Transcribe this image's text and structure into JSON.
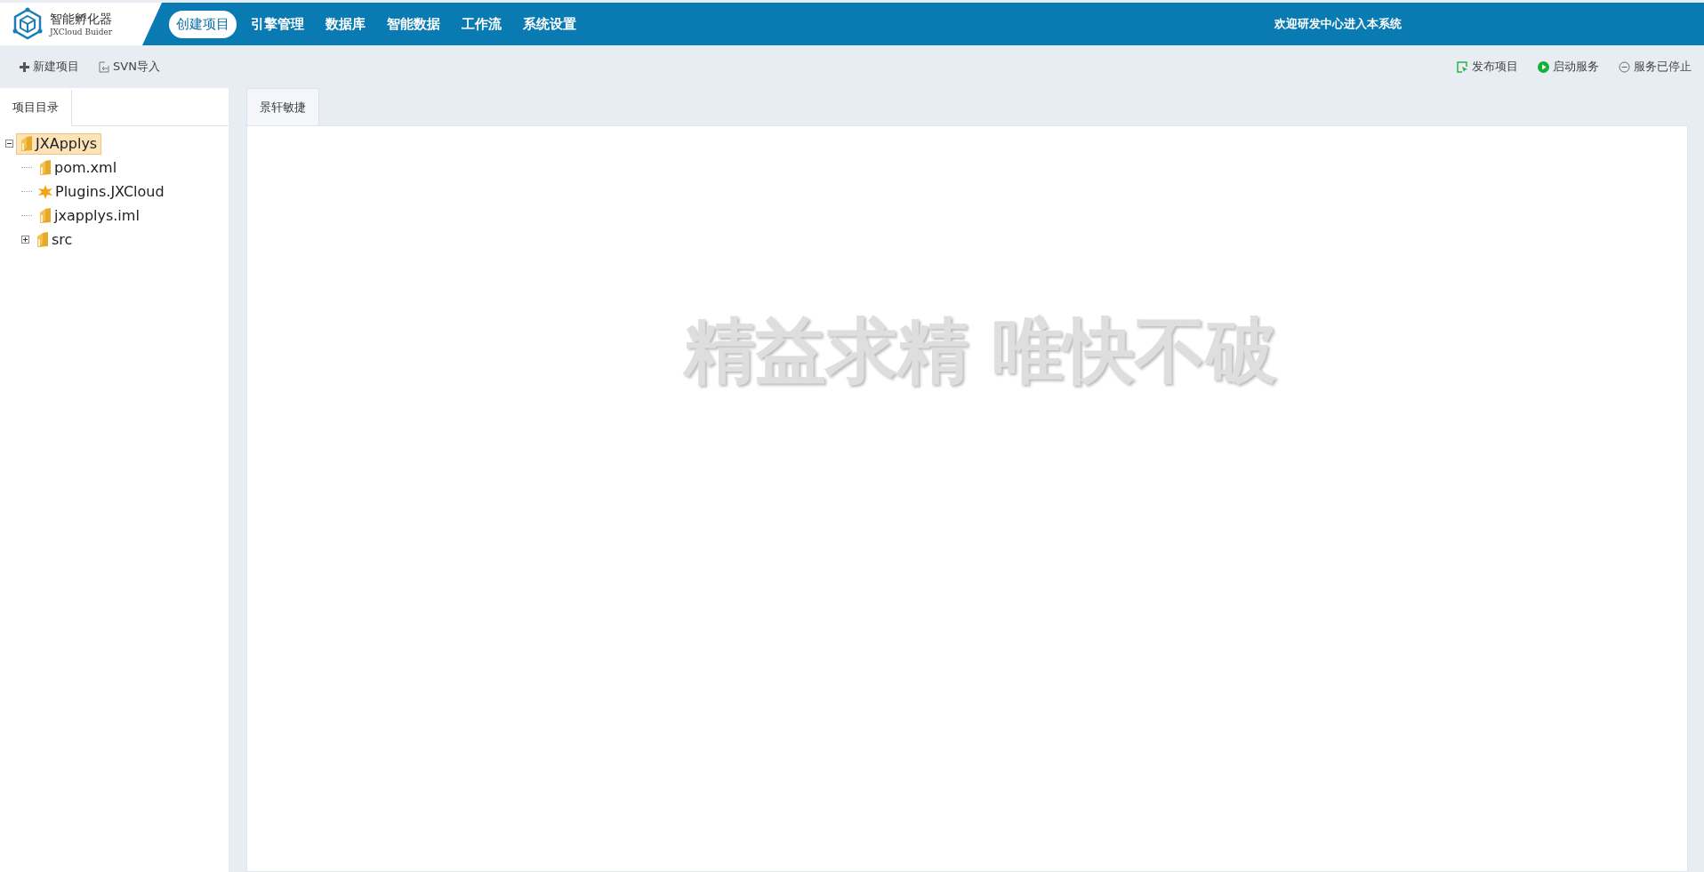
{
  "logo": {
    "title": "智能孵化器",
    "subtitle": "JXCloud Buider"
  },
  "nav": [
    {
      "label": "创建项目",
      "selected": true
    },
    {
      "label": "引擎管理",
      "selected": false
    },
    {
      "label": "数据库",
      "selected": false
    },
    {
      "label": "智能数据",
      "selected": false
    },
    {
      "label": "工作流",
      "selected": false
    },
    {
      "label": "系统设置",
      "selected": false
    }
  ],
  "welcome": "欢迎研发中心进入本系统",
  "toolbar_left": [
    {
      "kind": "plus",
      "label": "新建项目"
    },
    {
      "kind": "import",
      "label": "SVN导入"
    }
  ],
  "toolbar_right": [
    {
      "kind": "publish",
      "label": "发布项目"
    },
    {
      "kind": "start",
      "label": "启动服务"
    },
    {
      "kind": "stopped",
      "label": "服务已停止"
    }
  ],
  "sidebar": {
    "tab": "项目目录",
    "tree": [
      {
        "label": "JXApplys",
        "kind": "folder",
        "selected": true,
        "expanded": true,
        "children": [
          {
            "label": "pom.xml",
            "kind": "folder",
            "selected": false
          },
          {
            "label": "Plugins.JXCloud",
            "kind": "plugin",
            "selected": false
          },
          {
            "label": "jxapplys.iml",
            "kind": "folder",
            "selected": false
          },
          {
            "label": "src",
            "kind": "folder",
            "selected": false,
            "expanded": false
          }
        ]
      }
    ]
  },
  "content": {
    "tab": "景轩敏捷",
    "slogan": "精益求精 唯快不破"
  }
}
